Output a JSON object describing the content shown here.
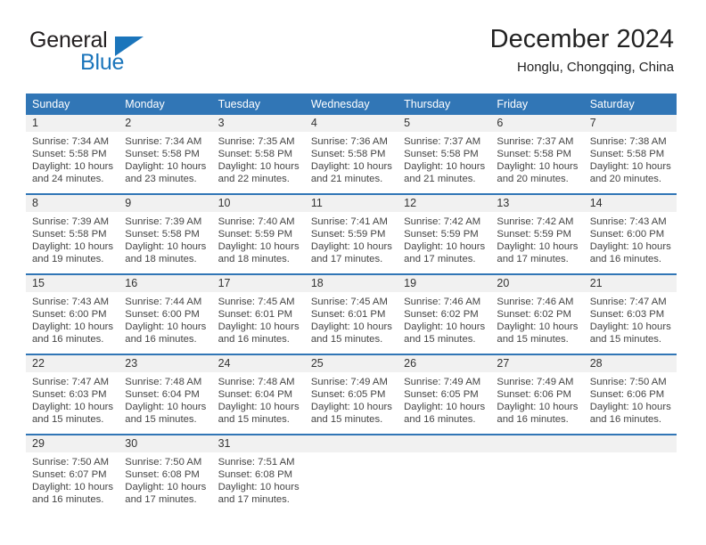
{
  "brand": {
    "word_one": "General",
    "word_two": "Blue",
    "colors": {
      "dark": "#231f20",
      "blue": "#1b75bb"
    }
  },
  "header": {
    "title": "December 2024",
    "subtitle": "Honglu, Chongqing, China"
  },
  "theme": {
    "header_blue": "#3176b6",
    "daynum_bg": "#f1f1f1",
    "text": "#444444"
  },
  "weekdays": [
    "Sunday",
    "Monday",
    "Tuesday",
    "Wednesday",
    "Thursday",
    "Friday",
    "Saturday"
  ],
  "labels": {
    "sunrise_prefix": "Sunrise:",
    "sunset_prefix": "Sunset:",
    "daylight_prefix": "Daylight:"
  },
  "weeks": [
    [
      {
        "day": "1",
        "sunrise": "Sunrise: 7:34 AM",
        "sunset": "Sunset: 5:58 PM",
        "daylight1": "Daylight: 10 hours",
        "daylight2": "and 24 minutes."
      },
      {
        "day": "2",
        "sunrise": "Sunrise: 7:34 AM",
        "sunset": "Sunset: 5:58 PM",
        "daylight1": "Daylight: 10 hours",
        "daylight2": "and 23 minutes."
      },
      {
        "day": "3",
        "sunrise": "Sunrise: 7:35 AM",
        "sunset": "Sunset: 5:58 PM",
        "daylight1": "Daylight: 10 hours",
        "daylight2": "and 22 minutes."
      },
      {
        "day": "4",
        "sunrise": "Sunrise: 7:36 AM",
        "sunset": "Sunset: 5:58 PM",
        "daylight1": "Daylight: 10 hours",
        "daylight2": "and 21 minutes."
      },
      {
        "day": "5",
        "sunrise": "Sunrise: 7:37 AM",
        "sunset": "Sunset: 5:58 PM",
        "daylight1": "Daylight: 10 hours",
        "daylight2": "and 21 minutes."
      },
      {
        "day": "6",
        "sunrise": "Sunrise: 7:37 AM",
        "sunset": "Sunset: 5:58 PM",
        "daylight1": "Daylight: 10 hours",
        "daylight2": "and 20 minutes."
      },
      {
        "day": "7",
        "sunrise": "Sunrise: 7:38 AM",
        "sunset": "Sunset: 5:58 PM",
        "daylight1": "Daylight: 10 hours",
        "daylight2": "and 20 minutes."
      }
    ],
    [
      {
        "day": "8",
        "sunrise": "Sunrise: 7:39 AM",
        "sunset": "Sunset: 5:58 PM",
        "daylight1": "Daylight: 10 hours",
        "daylight2": "and 19 minutes."
      },
      {
        "day": "9",
        "sunrise": "Sunrise: 7:39 AM",
        "sunset": "Sunset: 5:58 PM",
        "daylight1": "Daylight: 10 hours",
        "daylight2": "and 18 minutes."
      },
      {
        "day": "10",
        "sunrise": "Sunrise: 7:40 AM",
        "sunset": "Sunset: 5:59 PM",
        "daylight1": "Daylight: 10 hours",
        "daylight2": "and 18 minutes."
      },
      {
        "day": "11",
        "sunrise": "Sunrise: 7:41 AM",
        "sunset": "Sunset: 5:59 PM",
        "daylight1": "Daylight: 10 hours",
        "daylight2": "and 17 minutes."
      },
      {
        "day": "12",
        "sunrise": "Sunrise: 7:42 AM",
        "sunset": "Sunset: 5:59 PM",
        "daylight1": "Daylight: 10 hours",
        "daylight2": "and 17 minutes."
      },
      {
        "day": "13",
        "sunrise": "Sunrise: 7:42 AM",
        "sunset": "Sunset: 5:59 PM",
        "daylight1": "Daylight: 10 hours",
        "daylight2": "and 17 minutes."
      },
      {
        "day": "14",
        "sunrise": "Sunrise: 7:43 AM",
        "sunset": "Sunset: 6:00 PM",
        "daylight1": "Daylight: 10 hours",
        "daylight2": "and 16 minutes."
      }
    ],
    [
      {
        "day": "15",
        "sunrise": "Sunrise: 7:43 AM",
        "sunset": "Sunset: 6:00 PM",
        "daylight1": "Daylight: 10 hours",
        "daylight2": "and 16 minutes."
      },
      {
        "day": "16",
        "sunrise": "Sunrise: 7:44 AM",
        "sunset": "Sunset: 6:00 PM",
        "daylight1": "Daylight: 10 hours",
        "daylight2": "and 16 minutes."
      },
      {
        "day": "17",
        "sunrise": "Sunrise: 7:45 AM",
        "sunset": "Sunset: 6:01 PM",
        "daylight1": "Daylight: 10 hours",
        "daylight2": "and 16 minutes."
      },
      {
        "day": "18",
        "sunrise": "Sunrise: 7:45 AM",
        "sunset": "Sunset: 6:01 PM",
        "daylight1": "Daylight: 10 hours",
        "daylight2": "and 15 minutes."
      },
      {
        "day": "19",
        "sunrise": "Sunrise: 7:46 AM",
        "sunset": "Sunset: 6:02 PM",
        "daylight1": "Daylight: 10 hours",
        "daylight2": "and 15 minutes."
      },
      {
        "day": "20",
        "sunrise": "Sunrise: 7:46 AM",
        "sunset": "Sunset: 6:02 PM",
        "daylight1": "Daylight: 10 hours",
        "daylight2": "and 15 minutes."
      },
      {
        "day": "21",
        "sunrise": "Sunrise: 7:47 AM",
        "sunset": "Sunset: 6:03 PM",
        "daylight1": "Daylight: 10 hours",
        "daylight2": "and 15 minutes."
      }
    ],
    [
      {
        "day": "22",
        "sunrise": "Sunrise: 7:47 AM",
        "sunset": "Sunset: 6:03 PM",
        "daylight1": "Daylight: 10 hours",
        "daylight2": "and 15 minutes."
      },
      {
        "day": "23",
        "sunrise": "Sunrise: 7:48 AM",
        "sunset": "Sunset: 6:04 PM",
        "daylight1": "Daylight: 10 hours",
        "daylight2": "and 15 minutes."
      },
      {
        "day": "24",
        "sunrise": "Sunrise: 7:48 AM",
        "sunset": "Sunset: 6:04 PM",
        "daylight1": "Daylight: 10 hours",
        "daylight2": "and 15 minutes."
      },
      {
        "day": "25",
        "sunrise": "Sunrise: 7:49 AM",
        "sunset": "Sunset: 6:05 PM",
        "daylight1": "Daylight: 10 hours",
        "daylight2": "and 15 minutes."
      },
      {
        "day": "26",
        "sunrise": "Sunrise: 7:49 AM",
        "sunset": "Sunset: 6:05 PM",
        "daylight1": "Daylight: 10 hours",
        "daylight2": "and 16 minutes."
      },
      {
        "day": "27",
        "sunrise": "Sunrise: 7:49 AM",
        "sunset": "Sunset: 6:06 PM",
        "daylight1": "Daylight: 10 hours",
        "daylight2": "and 16 minutes."
      },
      {
        "day": "28",
        "sunrise": "Sunrise: 7:50 AM",
        "sunset": "Sunset: 6:06 PM",
        "daylight1": "Daylight: 10 hours",
        "daylight2": "and 16 minutes."
      }
    ],
    [
      {
        "day": "29",
        "sunrise": "Sunrise: 7:50 AM",
        "sunset": "Sunset: 6:07 PM",
        "daylight1": "Daylight: 10 hours",
        "daylight2": "and 16 minutes."
      },
      {
        "day": "30",
        "sunrise": "Sunrise: 7:50 AM",
        "sunset": "Sunset: 6:08 PM",
        "daylight1": "Daylight: 10 hours",
        "daylight2": "and 17 minutes."
      },
      {
        "day": "31",
        "sunrise": "Sunrise: 7:51 AM",
        "sunset": "Sunset: 6:08 PM",
        "daylight1": "Daylight: 10 hours",
        "daylight2": "and 17 minutes."
      },
      {
        "day": "",
        "sunrise": "",
        "sunset": "",
        "daylight1": "",
        "daylight2": ""
      },
      {
        "day": "",
        "sunrise": "",
        "sunset": "",
        "daylight1": "",
        "daylight2": ""
      },
      {
        "day": "",
        "sunrise": "",
        "sunset": "",
        "daylight1": "",
        "daylight2": ""
      },
      {
        "day": "",
        "sunrise": "",
        "sunset": "",
        "daylight1": "",
        "daylight2": ""
      }
    ]
  ]
}
